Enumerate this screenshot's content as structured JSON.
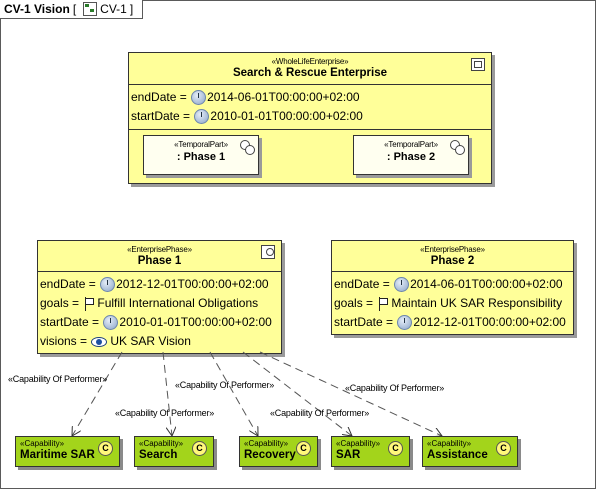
{
  "frame": {
    "title": "CV-1 Vision",
    "diagram_ref": "CV-1",
    "open_bracket": "[",
    "close_bracket": "]"
  },
  "enterprise": {
    "stereotype": "«WholeLifeEnterprise»",
    "name": "Search & Rescue Enterprise",
    "attrs": [
      {
        "key": "endDate",
        "eq": "=",
        "value": "2014-06-01T00:00:00+02:00"
      },
      {
        "key": "startDate",
        "eq": "=",
        "value": "2010-01-01T00:00:00+02:00"
      }
    ],
    "parts": [
      {
        "stereotype": "«TemporalPart»",
        "name": ": Phase 1"
      },
      {
        "stereotype": "«TemporalPart»",
        "name": ": Phase 2"
      }
    ]
  },
  "phase1": {
    "stereotype": "«EnterprisePhase»",
    "name": "Phase 1",
    "attrs": [
      {
        "key": "endDate",
        "eq": "=",
        "value": "2012-12-01T00:00:00+02:00",
        "icon": "clock-icon"
      },
      {
        "key": "goals",
        "eq": "=",
        "value": "Fulfill International Obligations",
        "icon": "flag-icon"
      },
      {
        "key": "startDate",
        "eq": "=",
        "value": "2010-01-01T00:00:00+02:00",
        "icon": "clock-icon"
      },
      {
        "key": "visions",
        "eq": "=",
        "value": "UK SAR Vision",
        "icon": "eye-icon"
      }
    ]
  },
  "phase2": {
    "stereotype": "«EnterprisePhase»",
    "name": "Phase 2",
    "attrs": [
      {
        "key": "endDate",
        "eq": "=",
        "value": "2014-06-01T00:00:00+02:00",
        "icon": "clock-icon"
      },
      {
        "key": "goals",
        "eq": "=",
        "value": "Maintain UK SAR Responsibility",
        "icon": "flag-icon"
      },
      {
        "key": "startDate",
        "eq": "=",
        "value": "2012-12-01T00:00:00+02:00",
        "icon": "clock-icon"
      }
    ]
  },
  "capabilities": [
    {
      "stereotype": "«Capability»",
      "name": "Maritime SAR",
      "icon_letter": "C"
    },
    {
      "stereotype": "«Capability»",
      "name": "Search",
      "icon_letter": "C"
    },
    {
      "stereotype": "«Capability»",
      "name": "Recovery",
      "icon_letter": "C"
    },
    {
      "stereotype": "«Capability»",
      "name": "SAR",
      "icon_letter": "C"
    },
    {
      "stereotype": "«Capability»",
      "name": "Assistance",
      "icon_letter": "C"
    }
  ],
  "links": [
    {
      "label": "«Capability Of Performer»"
    },
    {
      "label": "«Capability Of Performer»"
    },
    {
      "label": "«Capability Of Performer»"
    },
    {
      "label": "«Capability Of Performer»"
    },
    {
      "label": "«Capability Of Performer»"
    }
  ],
  "colors": {
    "class_fill": "#ffff99",
    "capability_fill": "#a3d41b",
    "border": "#333333"
  }
}
